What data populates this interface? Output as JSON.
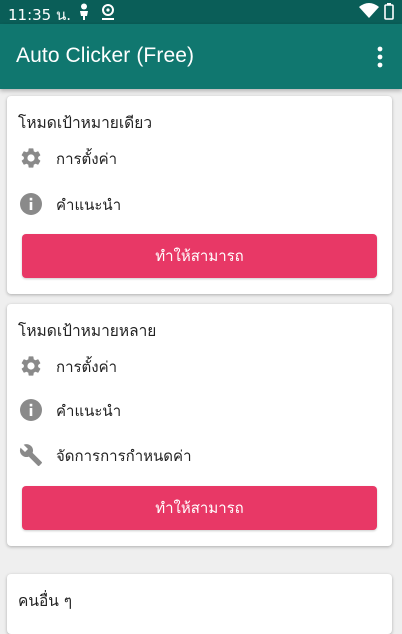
{
  "status_bar": {
    "time": "11:35 น."
  },
  "app_bar": {
    "title": "Auto Clicker (Free)",
    "menu_icon": "more-vert-icon"
  },
  "single_target": {
    "title": "โหมดเป้าหมายเดียว",
    "items": [
      {
        "icon": "gear-icon",
        "label": "การตั้งค่า"
      },
      {
        "icon": "info-icon",
        "label": "คำแนะนำ"
      }
    ],
    "enable_label": "ทำให้สามารถ"
  },
  "multi_target": {
    "title": "โหมดเป้าหมายหลาย",
    "items": [
      {
        "icon": "gear-icon",
        "label": "การตั้งค่า"
      },
      {
        "icon": "info-icon",
        "label": "คำแนะนำ"
      },
      {
        "icon": "wrench-icon",
        "label": "จัดการการกำหนดค่า"
      }
    ],
    "enable_label": "ทำให้สามารถ"
  },
  "others": {
    "title": "คนอื่น ๆ"
  },
  "colors": {
    "status_bar": "#0a5e58",
    "app_bar": "#10776f",
    "accent_button": "#e83866",
    "icon_gray": "#8a8a8a"
  }
}
